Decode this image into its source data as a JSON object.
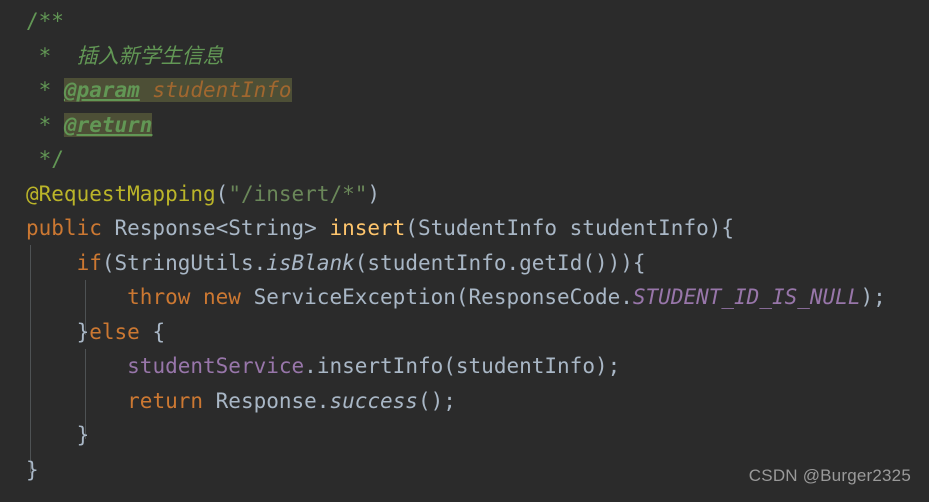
{
  "editor": {
    "background_color": "#2b2b2b",
    "theme_name": "Darcula",
    "language": "Java",
    "font_size_px": 21,
    "colors": {
      "comment": "#629755",
      "doc_tag": "#629755",
      "doc_tag_highlight": "#4d4f36",
      "doc_param": "#a1672f",
      "annotation": "#bbb529",
      "string": "#6a8759",
      "keyword": "#cc7832",
      "plain": "#a9b7c6",
      "method": "#ffc66d",
      "constant": "#9876aa",
      "field": "#9876aa",
      "indent_guide": "#4e5254",
      "watermark": "#9a9a9a"
    }
  },
  "code": {
    "lines": [
      {
        "id": "line-1-javadoc-open",
        "indent": 0,
        "tokens": [
          {
            "kind": "comment-plain",
            "text": "/**"
          }
        ]
      },
      {
        "id": "line-2-javadoc-description",
        "indent": 0,
        "tokens": [
          {
            "kind": "comment-plain",
            "text": " * "
          },
          {
            "kind": "comment",
            "text": " 插入新学生信息"
          }
        ]
      },
      {
        "id": "line-3-javadoc-param",
        "indent": 0,
        "tokens": [
          {
            "kind": "comment-plain",
            "text": " * "
          },
          {
            "kind": "doc-tag",
            "text": "@param"
          },
          {
            "kind": "doc-param",
            "text": " studentInfo"
          }
        ]
      },
      {
        "id": "line-4-javadoc-return",
        "indent": 0,
        "tokens": [
          {
            "kind": "comment-plain",
            "text": " * "
          },
          {
            "kind": "doc-tag",
            "text": "@return"
          }
        ]
      },
      {
        "id": "line-5-javadoc-close",
        "indent": 0,
        "tokens": [
          {
            "kind": "comment-plain",
            "text": " */"
          }
        ]
      },
      {
        "id": "line-6-request-mapping",
        "indent": 0,
        "tokens": [
          {
            "kind": "annot",
            "text": "@RequestMapping"
          },
          {
            "kind": "plain",
            "text": "("
          },
          {
            "kind": "string",
            "text": "\"/insert/*\""
          },
          {
            "kind": "plain",
            "text": ")"
          }
        ]
      },
      {
        "id": "line-7-method-signature",
        "indent": 0,
        "tokens": [
          {
            "kind": "keyword",
            "text": "public"
          },
          {
            "kind": "plain",
            "text": " Response<String> "
          },
          {
            "kind": "method",
            "text": "insert"
          },
          {
            "kind": "plain",
            "text": "(StudentInfo studentInfo){"
          }
        ]
      },
      {
        "id": "line-8-if-statement",
        "indent": 1,
        "tokens": [
          {
            "kind": "plain",
            "text": "    "
          },
          {
            "kind": "keyword",
            "text": "if"
          },
          {
            "kind": "plain",
            "text": "(StringUtils."
          },
          {
            "kind": "static",
            "text": "isBlank"
          },
          {
            "kind": "plain",
            "text": "(studentInfo.getId())){"
          }
        ]
      },
      {
        "id": "line-9-throw-exception",
        "indent": 2,
        "tokens": [
          {
            "kind": "plain",
            "text": "        "
          },
          {
            "kind": "keyword",
            "text": "throw new"
          },
          {
            "kind": "plain",
            "text": " ServiceException(ResponseCode."
          },
          {
            "kind": "const",
            "text": "STUDENT_ID_IS_NULL"
          },
          {
            "kind": "plain",
            "text": ");"
          }
        ]
      },
      {
        "id": "line-10-else",
        "indent": 1,
        "tokens": [
          {
            "kind": "plain",
            "text": "    }"
          },
          {
            "kind": "keyword",
            "text": "else"
          },
          {
            "kind": "plain",
            "text": " {"
          }
        ]
      },
      {
        "id": "line-11-service-call",
        "indent": 2,
        "tokens": [
          {
            "kind": "plain",
            "text": "        "
          },
          {
            "kind": "field",
            "text": "studentService"
          },
          {
            "kind": "plain",
            "text": ".insertInfo(studentInfo);"
          }
        ]
      },
      {
        "id": "line-12-return",
        "indent": 2,
        "tokens": [
          {
            "kind": "plain",
            "text": "        "
          },
          {
            "kind": "keyword",
            "text": "return"
          },
          {
            "kind": "plain",
            "text": " Response."
          },
          {
            "kind": "static",
            "text": "success"
          },
          {
            "kind": "plain",
            "text": "();"
          }
        ]
      },
      {
        "id": "line-13-close-else",
        "indent": 1,
        "tokens": [
          {
            "kind": "plain",
            "text": "    }"
          }
        ]
      },
      {
        "id": "line-14-close-method",
        "indent": 0,
        "tokens": [
          {
            "kind": "plain",
            "text": "}"
          }
        ]
      }
    ]
  },
  "watermark": {
    "text": "CSDN @Burger2325"
  }
}
